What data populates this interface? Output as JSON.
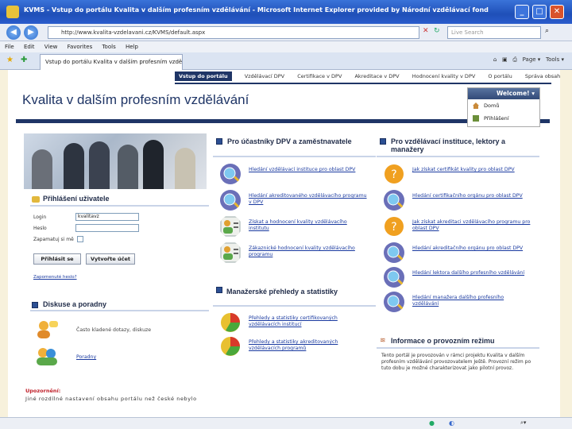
{
  "window": {
    "title": "KVMS - Vstup do portálu Kvalita v dalším profesním vzdělávání - Microsoft Internet Explorer provided by Národní vzdělávací fond",
    "min": "_",
    "max": "□",
    "close": "✕"
  },
  "addressbar": {
    "url": "http://www.kvalita-vzdelavani.cz/KVMS/default.aspx",
    "search_placeholder": "Live Search"
  },
  "menu": [
    "File",
    "Edit",
    "View",
    "Favorites",
    "Tools",
    "Help"
  ],
  "tab": {
    "label": "Vstup do portálu Kvalita v dalším profesním vzdělávání"
  },
  "toolbar": {
    "page": "Page ▾",
    "tools": "Tools ▾"
  },
  "site": {
    "nav": [
      "Vstup do portálu",
      "Vzdělávací DPV",
      "Certifikace v DPV",
      "Akreditace v DPV",
      "Hodnocení kvality v DPV",
      "O portálu",
      "Správa obsahu"
    ],
    "title": "Kvalita v dalším profesním vzdělávání",
    "welcome": {
      "label": "Welcome!",
      "home": "Domů",
      "login": "Přihlášení"
    }
  },
  "login": {
    "heading": "Přihlášení uživatele",
    "login_label": "Login",
    "login_value": "kvalitavz",
    "password_label": "Heslo",
    "remember_label": "Zapamatuj si mě",
    "login_button": "Přihlásit se",
    "create_button": "Vytvořte účet",
    "forgot_link": "Zapomenuté heslo?"
  },
  "discussion": {
    "heading": "Diskuse a poradny",
    "faq": "Často kladené dotazy, diskuze",
    "advice": "Poradny"
  },
  "notice": {
    "label": "Upozornění:",
    "text": "Jiné rozdílné nastavení obsahu portálu než české nebylo"
  },
  "participants": {
    "heading": "Pro účastníky DPV a zaměstnavatele",
    "links": [
      "Hledání vzdělávací instituce pro oblast DPV",
      "Hledání akreditovaného vzdělávacího programu v DPV",
      "Získat a hodnocení kvality vzdělávacího institutu",
      "Zákaznické hodnocení kvality vzdělávacího programu"
    ]
  },
  "managers": {
    "heading": "Manažerské přehledy a statistiky",
    "links": [
      "Přehledy a statistiky certifikovaných vzdělávacích institucí",
      "Přehledy a statistiky akreditovaných vzdělávacích programů"
    ]
  },
  "institutions": {
    "heading": "Pro vzdělávací instituce, lektory a manažery",
    "links": [
      "Jak získat certifikát kvality pro oblast DPV",
      "Hledání certifikačního orgánu pro oblast DPV",
      "Jak získat akreditaci vzdělávacího programu pro oblast DPV",
      "Hledání akreditačního orgánu pro oblast DPV",
      "Hledání lektora dalšího profesního vzdělávání",
      "Hledání manažera dalšího profesního vzdělávání"
    ]
  },
  "info": {
    "heading": "Informace o provozním režimu",
    "text": "Tento portál je provozován v rámci projektu Kvalita v dalším profesním vzdělávání provozovatelem Ještě. Provozní režim po tuto dobu je možné charakterizovat jako pilotní provoz."
  }
}
